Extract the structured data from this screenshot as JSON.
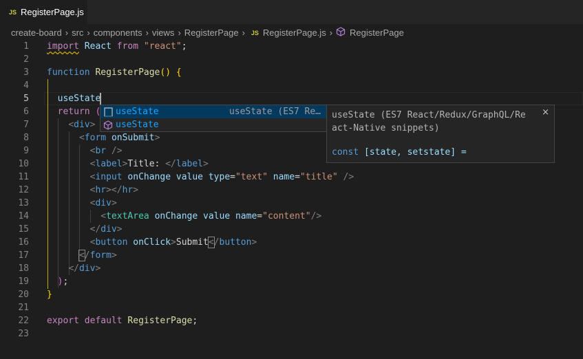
{
  "tab": {
    "icon": "JS",
    "title": "RegisterPage.js",
    "modified": true
  },
  "breadcrumbs": [
    "create-board",
    "src",
    "components",
    "views",
    "RegisterPage",
    "RegisterPage.js",
    "RegisterPage"
  ],
  "breadcrumb_js_icon": "JS",
  "code": {
    "current_line": 5,
    "lines": [
      [
        [
          "import",
          "k sq"
        ],
        [
          " ",
          "t"
        ],
        [
          "React",
          "v"
        ],
        [
          " ",
          "t"
        ],
        [
          "from",
          "k"
        ],
        [
          " ",
          "t"
        ],
        [
          "\"react\"",
          "s"
        ],
        [
          ";",
          "t"
        ]
      ],
      [],
      [
        [
          "function",
          "b"
        ],
        [
          " ",
          "t"
        ],
        [
          "RegisterPage",
          "f"
        ],
        [
          "()",
          "y"
        ],
        [
          " ",
          "t"
        ],
        [
          "{",
          "y"
        ]
      ],
      [],
      [
        [
          "  ",
          "t"
        ],
        [
          "useState",
          "v"
        ]
      ],
      [
        [
          "  ",
          "t"
        ],
        [
          "return",
          "k"
        ],
        [
          " ",
          "t"
        ],
        [
          "(",
          "m"
        ]
      ],
      [
        [
          "    ",
          "t"
        ],
        [
          "<",
          "p"
        ],
        [
          "div",
          "b"
        ],
        [
          ">",
          "p"
        ]
      ],
      [
        [
          "      ",
          "t"
        ],
        [
          "<",
          "p"
        ],
        [
          "form",
          "b"
        ],
        [
          " ",
          "t"
        ],
        [
          "onSubmit",
          "v"
        ],
        [
          ">",
          "p"
        ]
      ],
      [
        [
          "        ",
          "t"
        ],
        [
          "<",
          "p"
        ],
        [
          "br",
          "b"
        ],
        [
          " />",
          "p"
        ]
      ],
      [
        [
          "        ",
          "t"
        ],
        [
          "<",
          "p"
        ],
        [
          "label",
          "b"
        ],
        [
          ">",
          "p"
        ],
        [
          "Title: ",
          "t"
        ],
        [
          "</",
          "p"
        ],
        [
          "label",
          "b"
        ],
        [
          ">",
          "p"
        ]
      ],
      [
        [
          "        ",
          "t"
        ],
        [
          "<",
          "p"
        ],
        [
          "input",
          "b"
        ],
        [
          " ",
          "t"
        ],
        [
          "onChange",
          "v"
        ],
        [
          " ",
          "t"
        ],
        [
          "value",
          "v"
        ],
        [
          " ",
          "t"
        ],
        [
          "type",
          "v"
        ],
        [
          "=",
          "t"
        ],
        [
          "\"text\"",
          "s"
        ],
        [
          " ",
          "t"
        ],
        [
          "name",
          "v"
        ],
        [
          "=",
          "t"
        ],
        [
          "\"title\"",
          "s"
        ],
        [
          " />",
          "p"
        ]
      ],
      [
        [
          "        ",
          "t"
        ],
        [
          "<",
          "p"
        ],
        [
          "hr",
          "b"
        ],
        [
          "></",
          "p"
        ],
        [
          "hr",
          "b"
        ],
        [
          ">",
          "p"
        ]
      ],
      [
        [
          "        ",
          "t"
        ],
        [
          "<",
          "p"
        ],
        [
          "div",
          "b"
        ],
        [
          ">",
          "p"
        ]
      ],
      [
        [
          "          ",
          "t"
        ],
        [
          "<",
          "p"
        ],
        [
          "textArea",
          "g"
        ],
        [
          " ",
          "t"
        ],
        [
          "onChange",
          "v"
        ],
        [
          " ",
          "t"
        ],
        [
          "value",
          "v"
        ],
        [
          " ",
          "t"
        ],
        [
          "name",
          "v"
        ],
        [
          "=",
          "t"
        ],
        [
          "\"content\"",
          "s"
        ],
        [
          "/>",
          "p"
        ]
      ],
      [
        [
          "        ",
          "t"
        ],
        [
          "</",
          "p"
        ],
        [
          "div",
          "b"
        ],
        [
          ">",
          "p"
        ]
      ],
      [
        [
          "        ",
          "t"
        ],
        [
          "<",
          "p"
        ],
        [
          "button",
          "b"
        ],
        [
          " ",
          "t"
        ],
        [
          "onClick",
          "v"
        ],
        [
          ">",
          "p"
        ],
        [
          "Submit",
          "t"
        ],
        [
          "<",
          "p bm"
        ],
        [
          "/",
          "p"
        ],
        [
          "button",
          "b"
        ],
        [
          ">",
          "p"
        ]
      ],
      [
        [
          "      ",
          "t"
        ],
        [
          "<",
          "p bm"
        ],
        [
          "/",
          "p"
        ],
        [
          "form",
          "b"
        ],
        [
          ">",
          "p"
        ]
      ],
      [
        [
          "    ",
          "t"
        ],
        [
          "</",
          "p"
        ],
        [
          "div",
          "b"
        ],
        [
          ">",
          "p"
        ]
      ],
      [
        [
          "  ",
          "t"
        ],
        [
          ")",
          "m"
        ],
        [
          ";",
          "t"
        ]
      ],
      [
        [
          "}",
          "y"
        ]
      ],
      [],
      [
        [
          "export",
          "k"
        ],
        [
          " ",
          "t"
        ],
        [
          "default",
          "k"
        ],
        [
          " ",
          "t"
        ],
        [
          "RegisterPage",
          "f"
        ],
        [
          ";",
          "t"
        ]
      ],
      []
    ]
  },
  "suggest": {
    "items": [
      {
        "label": "useState",
        "detail": "useState (ES7 Re…",
        "icon": "snippet-icon"
      },
      {
        "label": "useState",
        "icon": "module-cube-icon"
      }
    ]
  },
  "details": {
    "description": "useState (ES7 React/Redux/GraphQL/React-Native snippets)",
    "code_keyword": "const",
    "code_rest": " [state, setstate] =",
    "close": "×"
  },
  "colors": {
    "accent": "#18a3ff",
    "selection": "#04395e",
    "bracket_guide": "#c8a800"
  }
}
